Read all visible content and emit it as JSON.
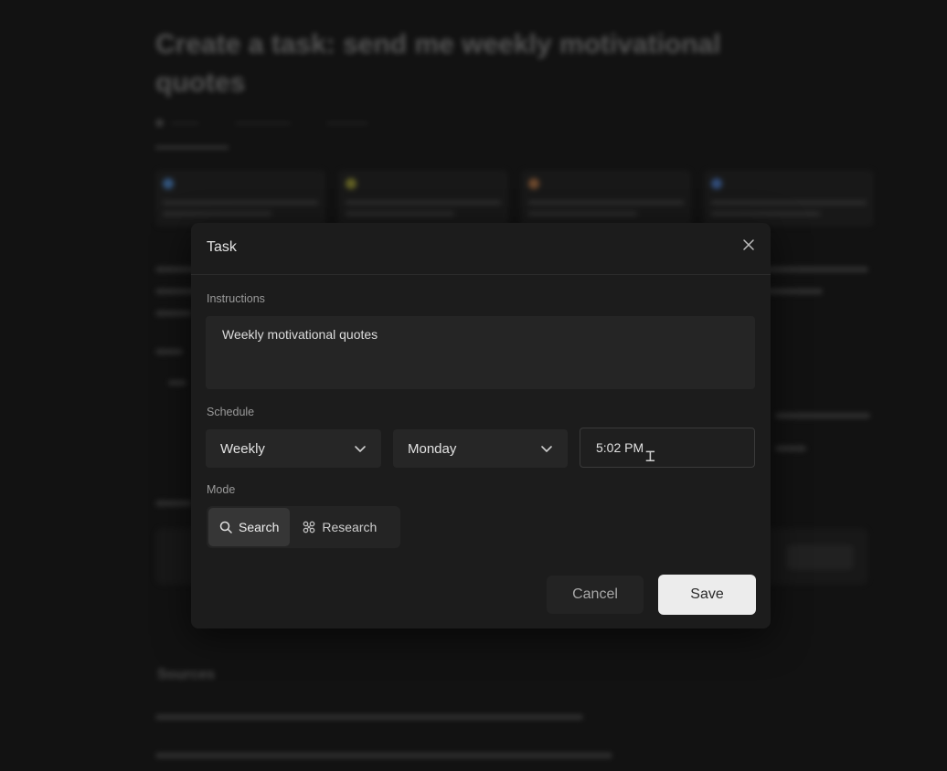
{
  "modal": {
    "title": "Task",
    "instructions_label": "Instructions",
    "instructions_value": "Weekly motivational quotes",
    "schedule_label": "Schedule",
    "frequency": "Weekly",
    "day": "Monday",
    "time": "5:02 PM",
    "mode_label": "Mode",
    "modes": [
      {
        "label": "Search",
        "icon": "search-icon",
        "active": true
      },
      {
        "label": "Research",
        "icon": "research-icon",
        "active": false
      }
    ],
    "cancel_label": "Cancel",
    "save_label": "Save"
  },
  "background": {
    "title": "Create a task: send me weekly motivational quotes",
    "sources_label": "Sources"
  },
  "colors": {
    "modal_bg": "#1c1c1c",
    "save_bg": "#ececec",
    "input_bg": "#262626"
  }
}
